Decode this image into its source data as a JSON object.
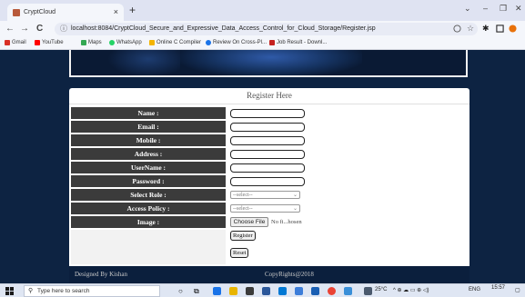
{
  "browser": {
    "tab_title": "CryptCloud",
    "tab_close": "×",
    "new_tab": "+",
    "window_controls": {
      "minimize": "–",
      "restore": "❐",
      "close": "✕"
    },
    "nav": {
      "back": "←",
      "forward": "→",
      "reload": "C"
    },
    "url": "localhost:8084/CryptCloud_Secure_and_Expressive_Data_Access_Control_for_Cloud_Storage/Register.jsp",
    "bookmarks": [
      {
        "label": "Gmail",
        "color": "#d93025"
      },
      {
        "label": "YouTube",
        "color": "#ff0000"
      },
      {
        "label": "Maps",
        "color": "#34a853"
      },
      {
        "label": "WhatsApp",
        "color": "#25d366"
      },
      {
        "label": "Online C Compiler",
        "color": "#f4b400"
      },
      {
        "label": "Review On Cross-Pl...",
        "color": "#1a73e8"
      },
      {
        "label": "Job Result - Downl...",
        "color": "#c5221f"
      }
    ]
  },
  "form": {
    "title": "Register Here",
    "fields": [
      {
        "label": "Name :"
      },
      {
        "label": "Email :"
      },
      {
        "label": "Mobile :"
      },
      {
        "label": "Address :"
      },
      {
        "label": "UserName :"
      },
      {
        "label": "Password :"
      }
    ],
    "select_role": {
      "label": "Select Role :",
      "value": "--select--"
    },
    "access_policy": {
      "label": "Access Policy :",
      "value": "--select--"
    },
    "image": {
      "label": "Image :",
      "button": "Choose File",
      "filename": "No fi...hosen"
    },
    "register_button": "Register",
    "reset_button": "Reset"
  },
  "footer": {
    "left": "Designed By Kishan",
    "right": "CopyRights@2018"
  },
  "taskbar": {
    "search_placeholder": "Type here to search",
    "weather": "25°C",
    "language": "ENG",
    "time": "15:57"
  },
  "colors": {
    "page_background": "#0d2342",
    "label_cell": "#3b3b3b",
    "browser_chrome": "#dfe3f2"
  }
}
